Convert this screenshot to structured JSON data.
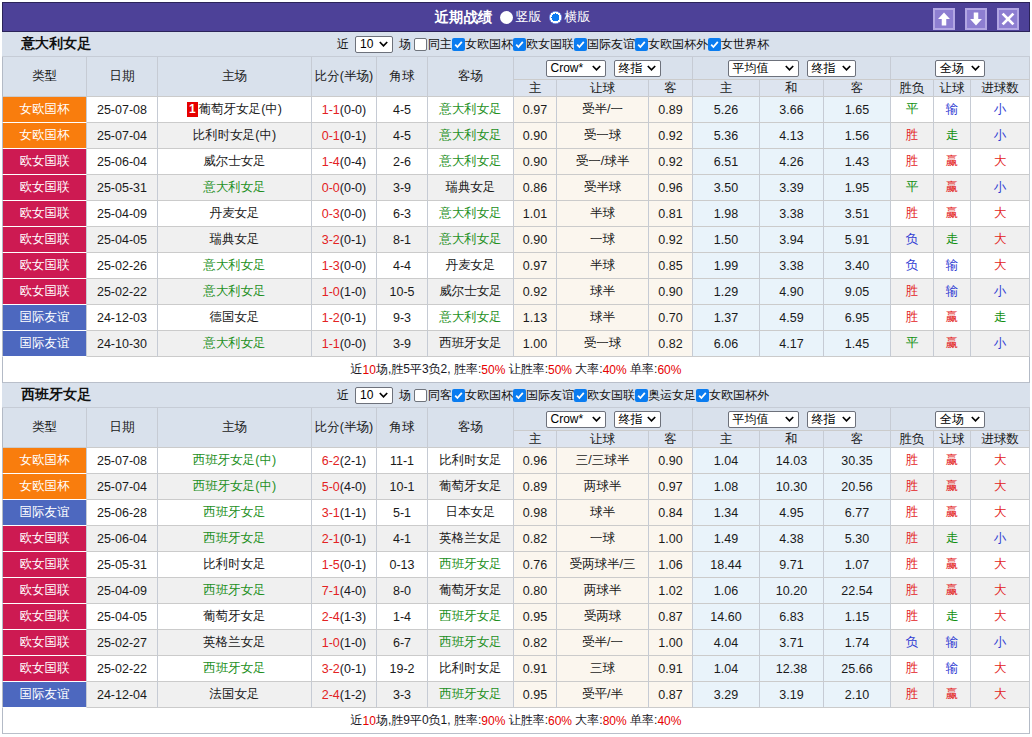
{
  "titlebar": {
    "title": "近期战绩",
    "radio_vertical_label": "竖版",
    "radio_horizontal_label": "横版",
    "selected_layout": "横版",
    "buttons": [
      "move-up",
      "move-down",
      "close"
    ]
  },
  "colors": {
    "bar_purple": "#4d4198",
    "header_bg": "#d9e1ec",
    "badge_colors": {
      "女欧国杯": "#f97d0d",
      "欧女国联": "#cd1a52",
      "国际友谊": "#4d68bf"
    },
    "result_colors": {
      "胜": "#e32222",
      "平": "#0f8f0f",
      "负": "#2f3bd3",
      "赢": "#e32222",
      "输": "#2f3bd3",
      "走": "#0f8f0f",
      "大": "#e32222",
      "小": "#2f3bd3"
    },
    "subject_team_green": "#1d8f1d",
    "score_red": "#e32222"
  },
  "table_headers": {
    "left": [
      "类型",
      "日期",
      "主场",
      "比分(半场)",
      "角球",
      "客场"
    ],
    "sub": [
      "主",
      "让球",
      "客",
      "主",
      "和",
      "客",
      "胜负",
      "让球",
      "进球数"
    ],
    "select_odds_source": "Crow*",
    "select_odds_time_1": "终指",
    "select_average": "平均值",
    "select_odds_time_2": "终指",
    "select_scope": "全场"
  },
  "filter_labels": {
    "near": "近",
    "count": "10",
    "games": "场"
  },
  "sections": [
    {
      "team": "意大利女足",
      "same_label": "同主",
      "same_checked": false,
      "competitions": [
        "女欧国杯",
        "欧女国联",
        "国际友谊",
        "女欧国杯外",
        "女世界杯"
      ],
      "rows": [
        {
          "type": "女欧国杯",
          "date": "25-07-08",
          "home": "葡萄牙女足(中)",
          "home_mark": "1",
          "score": "1-1",
          "half": "(0-0)",
          "corner": "4-5",
          "away": "意大利女足",
          "odds": [
            "0.97",
            "受半/一",
            "0.89"
          ],
          "avg": [
            "5.26",
            "3.66",
            "1.65"
          ],
          "results": [
            "平",
            "输",
            "小"
          ]
        },
        {
          "type": "女欧国杯",
          "date": "25-07-04",
          "home": "比利时女足(中)",
          "score": "0-1",
          "half": "(0-1)",
          "corner": "4-5",
          "away": "意大利女足",
          "odds": [
            "0.90",
            "受一球",
            "0.92"
          ],
          "avg": [
            "5.36",
            "4.13",
            "1.56"
          ],
          "results": [
            "胜",
            "走",
            "小"
          ]
        },
        {
          "type": "欧女国联",
          "date": "25-06-04",
          "home": "威尔士女足",
          "score": "1-4",
          "half": "(0-4)",
          "corner": "2-6",
          "away": "意大利女足",
          "odds": [
            "0.90",
            "受一/球半",
            "0.92"
          ],
          "avg": [
            "6.51",
            "4.26",
            "1.43"
          ],
          "results": [
            "胜",
            "赢",
            "大"
          ]
        },
        {
          "type": "欧女国联",
          "date": "25-05-31",
          "home": "意大利女足",
          "score": "0-0",
          "half": "(0-0)",
          "corner": "3-9",
          "away": "瑞典女足",
          "odds": [
            "0.86",
            "受半球",
            "0.96"
          ],
          "avg": [
            "3.50",
            "3.39",
            "1.95"
          ],
          "results": [
            "平",
            "赢",
            "小"
          ]
        },
        {
          "type": "欧女国联",
          "date": "25-04-09",
          "home": "丹麦女足",
          "score": "0-3",
          "half": "(0-0)",
          "corner": "6-3",
          "away": "意大利女足",
          "odds": [
            "1.01",
            "半球",
            "0.81"
          ],
          "avg": [
            "1.98",
            "3.38",
            "3.51"
          ],
          "results": [
            "胜",
            "赢",
            "大"
          ]
        },
        {
          "type": "欧女国联",
          "date": "25-04-05",
          "home": "瑞典女足",
          "score": "3-2",
          "half": "(0-1)",
          "corner": "8-1",
          "away": "意大利女足",
          "odds": [
            "0.90",
            "一球",
            "0.92"
          ],
          "avg": [
            "1.50",
            "3.94",
            "5.91"
          ],
          "results": [
            "负",
            "走",
            "大"
          ]
        },
        {
          "type": "欧女国联",
          "date": "25-02-26",
          "home": "意大利女足",
          "score": "1-3",
          "half": "(0-0)",
          "corner": "4-4",
          "away": "丹麦女足",
          "odds": [
            "0.97",
            "半球",
            "0.85"
          ],
          "avg": [
            "1.99",
            "3.38",
            "3.40"
          ],
          "results": [
            "负",
            "输",
            "大"
          ]
        },
        {
          "type": "欧女国联",
          "date": "25-02-22",
          "home": "意大利女足",
          "score": "1-0",
          "half": "(1-0)",
          "corner": "10-5",
          "away": "威尔士女足",
          "odds": [
            "0.92",
            "球半",
            "0.90"
          ],
          "avg": [
            "1.29",
            "4.90",
            "9.05"
          ],
          "results": [
            "胜",
            "输",
            "小"
          ]
        },
        {
          "type": "国际友谊",
          "date": "24-12-03",
          "home": "德国女足",
          "score": "1-2",
          "half": "(0-1)",
          "corner": "9-3",
          "away": "意大利女足",
          "odds": [
            "1.13",
            "球半",
            "0.70"
          ],
          "avg": [
            "1.37",
            "4.59",
            "6.95"
          ],
          "results": [
            "胜",
            "赢",
            "走"
          ]
        },
        {
          "type": "国际友谊",
          "date": "24-10-30",
          "home": "意大利女足",
          "score": "1-1",
          "half": "(0-0)",
          "corner": "3-9",
          "away": "西班牙女足",
          "odds": [
            "1.00",
            "受一球",
            "0.82"
          ],
          "avg": [
            "6.06",
            "4.17",
            "1.45"
          ],
          "results": [
            "平",
            "赢",
            "小"
          ]
        }
      ],
      "summary": [
        [
          "近",
          "d"
        ],
        [
          "10",
          "r"
        ],
        [
          "场,胜5平3负2, 胜率:",
          "d"
        ],
        [
          "50%",
          "r"
        ],
        [
          " 让胜率:",
          "d"
        ],
        [
          "50%",
          "r"
        ],
        [
          " 大率:",
          "d"
        ],
        [
          "40%",
          "r"
        ],
        [
          " 单率:",
          "d"
        ],
        [
          "60%",
          "r"
        ]
      ]
    },
    {
      "team": "西班牙女足",
      "same_label": "同客",
      "same_checked": false,
      "competitions": [
        "女欧国杯",
        "国际友谊",
        "欧女国联",
        "奥运女足",
        "女欧国杯外"
      ],
      "rows": [
        {
          "type": "女欧国杯",
          "date": "25-07-08",
          "home": "西班牙女足(中)",
          "score": "6-2",
          "half": "(2-1)",
          "corner": "11-1",
          "away": "比利时女足",
          "odds": [
            "0.96",
            "三/三球半",
            "0.90"
          ],
          "avg": [
            "1.04",
            "14.03",
            "30.35"
          ],
          "results": [
            "胜",
            "赢",
            "大"
          ]
        },
        {
          "type": "女欧国杯",
          "date": "25-07-04",
          "home": "西班牙女足(中)",
          "score": "5-0",
          "half": "(4-0)",
          "corner": "10-1",
          "away": "葡萄牙女足",
          "odds": [
            "0.89",
            "两球半",
            "0.97"
          ],
          "avg": [
            "1.08",
            "10.30",
            "20.56"
          ],
          "results": [
            "胜",
            "赢",
            "大"
          ]
        },
        {
          "type": "国际友谊",
          "date": "25-06-28",
          "home": "西班牙女足",
          "score": "3-1",
          "half": "(1-1)",
          "corner": "5-1",
          "away": "日本女足",
          "odds": [
            "0.98",
            "球半",
            "0.84"
          ],
          "avg": [
            "1.34",
            "4.95",
            "6.77"
          ],
          "results": [
            "胜",
            "赢",
            "大"
          ]
        },
        {
          "type": "欧女国联",
          "date": "25-06-04",
          "home": "西班牙女足",
          "score": "2-1",
          "half": "(0-1)",
          "corner": "4-1",
          "away": "英格兰女足",
          "odds": [
            "0.82",
            "一球",
            "1.00"
          ],
          "avg": [
            "1.49",
            "4.38",
            "5.30"
          ],
          "results": [
            "胜",
            "走",
            "小"
          ]
        },
        {
          "type": "欧女国联",
          "date": "25-05-31",
          "home": "比利时女足",
          "score": "1-5",
          "half": "(0-1)",
          "corner": "0-13",
          "away": "西班牙女足",
          "odds": [
            "0.76",
            "受两球半/三",
            "1.06"
          ],
          "avg": [
            "18.44",
            "9.71",
            "1.07"
          ],
          "results": [
            "胜",
            "赢",
            "大"
          ]
        },
        {
          "type": "欧女国联",
          "date": "25-04-09",
          "home": "西班牙女足",
          "score": "7-1",
          "half": "(4-0)",
          "corner": "8-0",
          "away": "葡萄牙女足",
          "odds": [
            "0.80",
            "两球半",
            "1.02"
          ],
          "avg": [
            "1.06",
            "10.20",
            "22.54"
          ],
          "results": [
            "胜",
            "赢",
            "大"
          ]
        },
        {
          "type": "欧女国联",
          "date": "25-04-05",
          "home": "葡萄牙女足",
          "score": "2-4",
          "half": "(1-3)",
          "corner": "1-4",
          "away": "西班牙女足",
          "odds": [
            "0.95",
            "受两球",
            "0.87"
          ],
          "avg": [
            "14.60",
            "6.83",
            "1.15"
          ],
          "results": [
            "胜",
            "走",
            "大"
          ]
        },
        {
          "type": "欧女国联",
          "date": "25-02-27",
          "home": "英格兰女足",
          "score": "1-0",
          "half": "(1-0)",
          "corner": "6-7",
          "away": "西班牙女足",
          "odds": [
            "0.82",
            "受半/一",
            "1.00"
          ],
          "avg": [
            "4.04",
            "3.71",
            "1.74"
          ],
          "results": [
            "负",
            "输",
            "小"
          ]
        },
        {
          "type": "欧女国联",
          "date": "25-02-22",
          "home": "西班牙女足",
          "score": "3-2",
          "half": "(0-1)",
          "corner": "19-2",
          "away": "比利时女足",
          "odds": [
            "0.91",
            "三球",
            "0.91"
          ],
          "avg": [
            "1.04",
            "12.38",
            "25.66"
          ],
          "results": [
            "胜",
            "输",
            "大"
          ]
        },
        {
          "type": "国际友谊",
          "date": "24-12-04",
          "home": "法国女足",
          "score": "2-4",
          "half": "(1-2)",
          "corner": "3-3",
          "away": "西班牙女足",
          "odds": [
            "0.95",
            "受平/半",
            "0.87"
          ],
          "avg": [
            "3.29",
            "3.19",
            "2.10"
          ],
          "results": [
            "胜",
            "赢",
            "大"
          ]
        }
      ],
      "summary": [
        [
          "近",
          "d"
        ],
        [
          "10",
          "r"
        ],
        [
          "场,胜9平0负1, 胜率:",
          "d"
        ],
        [
          "90%",
          "r"
        ],
        [
          " 让胜率:",
          "d"
        ],
        [
          "60%",
          "r"
        ],
        [
          " 大率:",
          "d"
        ],
        [
          "80%",
          "r"
        ],
        [
          " 单率:",
          "d"
        ],
        [
          "40%",
          "r"
        ]
      ]
    }
  ]
}
